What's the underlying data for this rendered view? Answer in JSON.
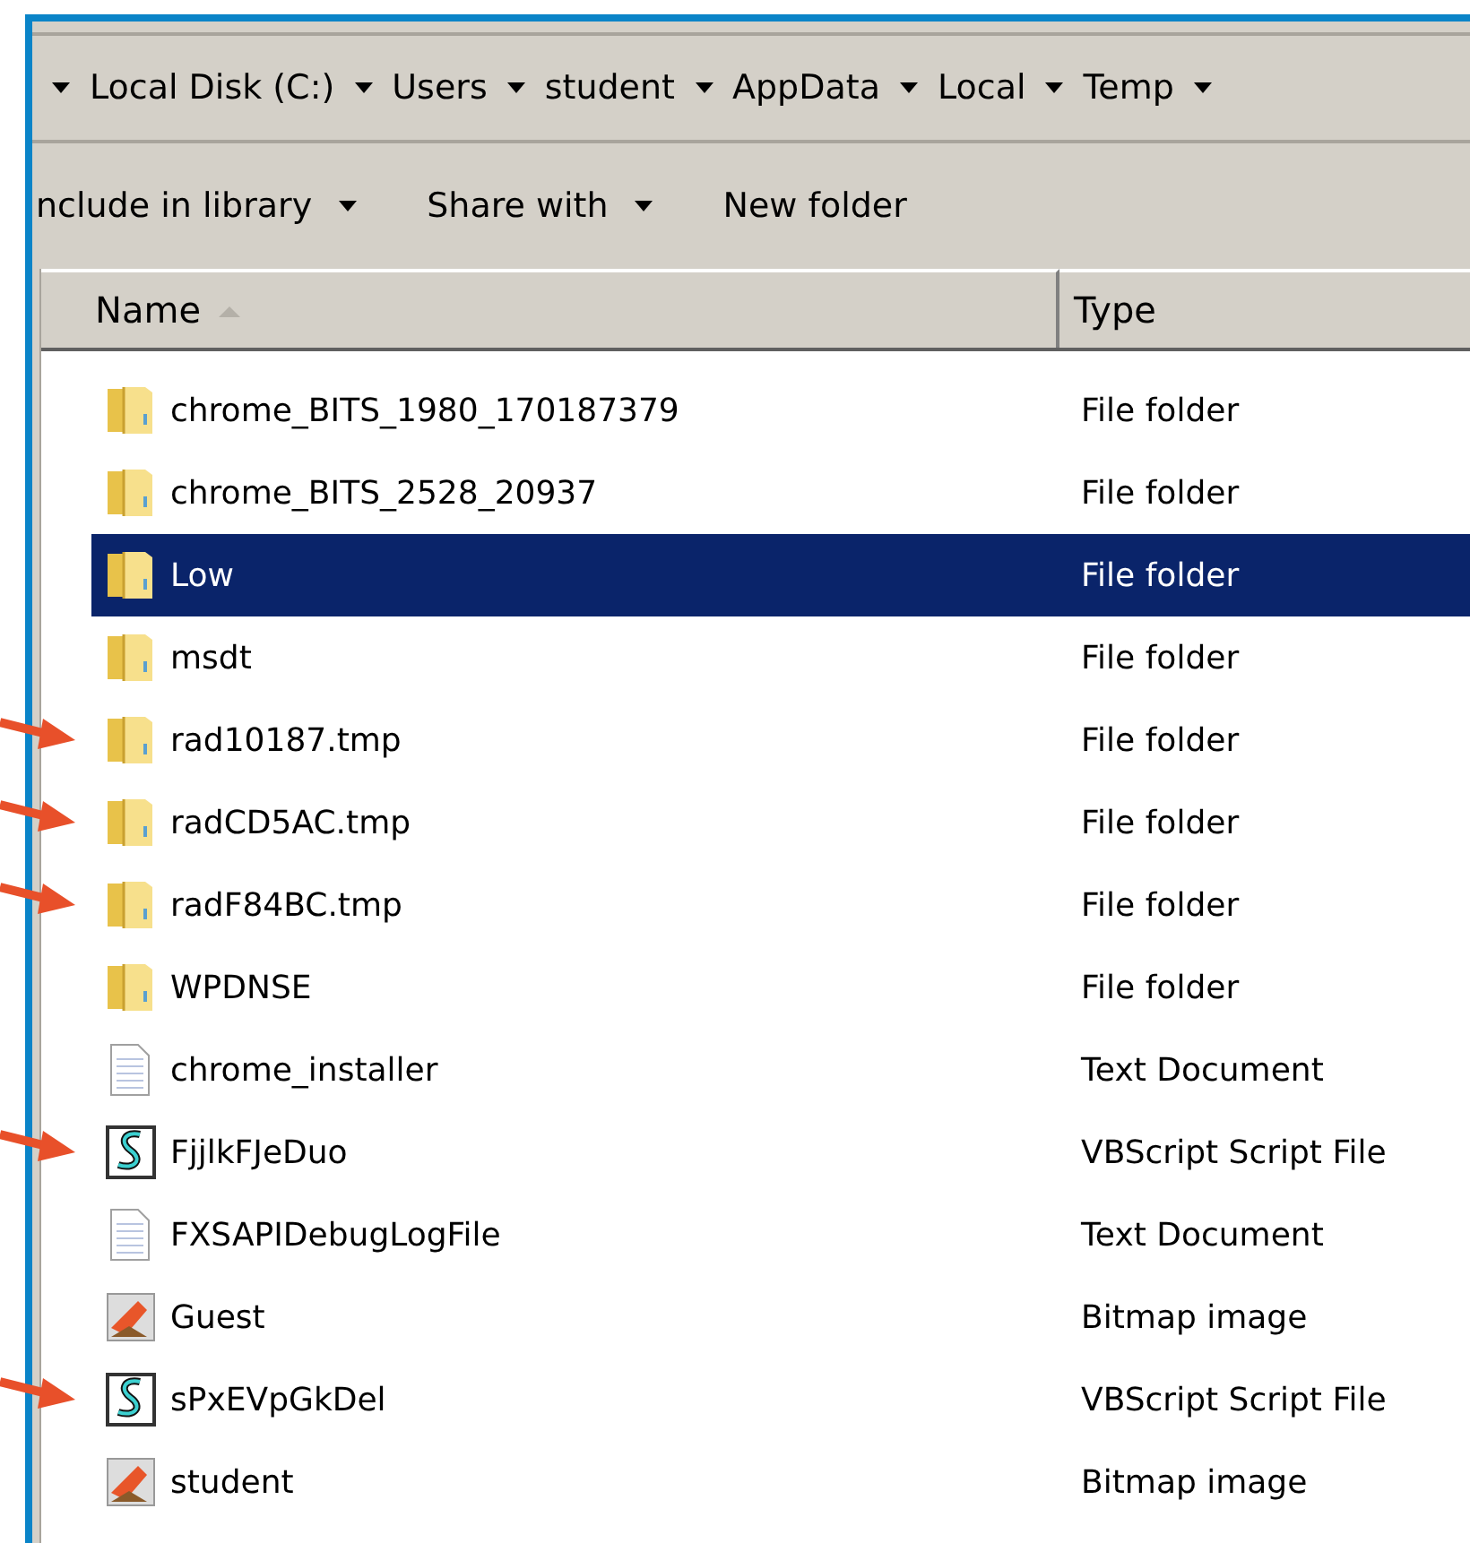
{
  "address_bar": {
    "crumbs": [
      "Local Disk (C:)",
      "Users",
      "student",
      "AppData",
      "Local",
      "Temp"
    ]
  },
  "toolbar": {
    "buttons": [
      {
        "label": "nclude in library",
        "dropdown": true
      },
      {
        "label": "Share with",
        "dropdown": true
      },
      {
        "label": "New folder",
        "dropdown": false
      }
    ]
  },
  "file_list": {
    "columns": [
      {
        "label": "Name",
        "sorted": true
      },
      {
        "label": "Type",
        "sorted": false
      }
    ],
    "rows": [
      {
        "name": "chrome_BITS_1980_170187379",
        "type": "File folder",
        "kind": "folder",
        "selected": false,
        "flagged": false
      },
      {
        "name": "chrome_BITS_2528_20937",
        "type": "File folder",
        "kind": "folder",
        "selected": false,
        "flagged": false
      },
      {
        "name": "Low",
        "type": "File folder",
        "kind": "folder",
        "selected": true,
        "flagged": false
      },
      {
        "name": "msdt",
        "type": "File folder",
        "kind": "folder",
        "selected": false,
        "flagged": false
      },
      {
        "name": "rad10187.tmp",
        "type": "File folder",
        "kind": "folder",
        "selected": false,
        "flagged": true
      },
      {
        "name": "radCD5AC.tmp",
        "type": "File folder",
        "kind": "folder",
        "selected": false,
        "flagged": true
      },
      {
        "name": "radF84BC.tmp",
        "type": "File folder",
        "kind": "folder",
        "selected": false,
        "flagged": true
      },
      {
        "name": "WPDNSE",
        "type": "File folder",
        "kind": "folder",
        "selected": false,
        "flagged": false
      },
      {
        "name": "chrome_installer",
        "type": "Text Document",
        "kind": "text",
        "selected": false,
        "flagged": false
      },
      {
        "name": "FjjlkFJeDuo",
        "type": "VBScript Script File",
        "kind": "script",
        "selected": false,
        "flagged": true
      },
      {
        "name": "FXSAPIDebugLogFile",
        "type": "Text Document",
        "kind": "text",
        "selected": false,
        "flagged": false
      },
      {
        "name": "Guest",
        "type": "Bitmap image",
        "kind": "bitmap",
        "selected": false,
        "flagged": false
      },
      {
        "name": "sPxEVpGkDel",
        "type": "VBScript Script File",
        "kind": "script",
        "selected": false,
        "flagged": true
      },
      {
        "name": "student",
        "type": "Bitmap image",
        "kind": "bitmap",
        "selected": false,
        "flagged": false
      }
    ]
  }
}
